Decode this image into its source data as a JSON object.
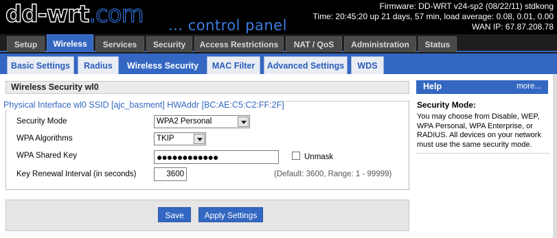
{
  "header": {
    "logo_main": "dd-wrt",
    "logo_suffix": ".com",
    "tagline": "... control panel",
    "firmware": "Firmware: DD-WRT v24-sp2 (08/22/11) stdkong",
    "time": "Time: 20:45:20 up 21 days, 57 min, load average: 0.08, 0.01, 0.00",
    "wan_ip": "WAN IP: 67.87.208.78"
  },
  "main_tabs": [
    {
      "label": "Setup"
    },
    {
      "label": "Wireless"
    },
    {
      "label": "Services"
    },
    {
      "label": "Security"
    },
    {
      "label": "Access Restrictions"
    },
    {
      "label": "NAT / QoS"
    },
    {
      "label": "Administration"
    },
    {
      "label": "Status"
    }
  ],
  "active_main_tab": "Wireless",
  "sub_tabs": [
    {
      "label": "Basic Settings"
    },
    {
      "label": "Radius"
    },
    {
      "label": "Wireless Security"
    },
    {
      "label": "MAC Filter"
    },
    {
      "label": "Advanced Settings"
    },
    {
      "label": "WDS"
    }
  ],
  "active_sub_tab": "Wireless Security",
  "section": {
    "title": "Wireless Security wl0",
    "legend": "Physical Interface wl0 SSID [ajc_basment] HWAddr [BC:AE:C5:C2:FF:2F]"
  },
  "form": {
    "security_mode": {
      "label": "Security Mode",
      "value": "WPA2 Personal"
    },
    "wpa_algorithms": {
      "label": "WPA Algorithms",
      "value": "TKIP"
    },
    "wpa_shared_key": {
      "label": "WPA Shared Key",
      "value": "●●●●●●●●●●●●",
      "unmask_label": "Unmask",
      "unmask_checked": false
    },
    "key_renewal": {
      "label": "Key Renewal Interval (in seconds)",
      "value": "3600",
      "hint": "(Default: 3600, Range: 1 - 99999)"
    }
  },
  "buttons": {
    "save": "Save",
    "apply": "Apply Settings"
  },
  "help": {
    "title": "Help",
    "more": "more...",
    "heading": "Security Mode:",
    "text": "You may choose from Disable, WEP, WPA Personal, WPA Enterprise, or RADIUS. All devices on your network must use the same security mode."
  },
  "colors": {
    "accent": "#3467c2",
    "header_bg": "#000000",
    "tab_inactive": "#4a4a4a"
  }
}
